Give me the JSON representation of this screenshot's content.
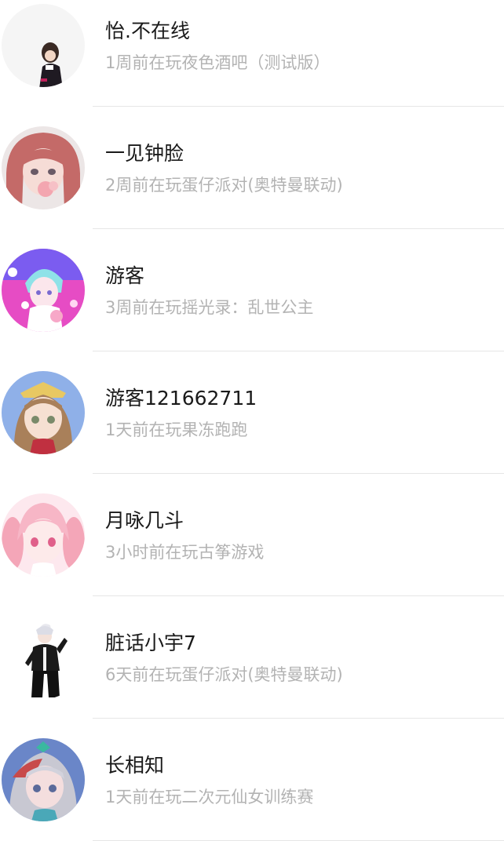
{
  "friends": [
    {
      "name": "怡.不在线",
      "status": "1周前在玩夜色酒吧（测试版）",
      "avatar_icon": "chibi-character-avatar-icon"
    },
    {
      "name": "一见钟脸",
      "status": "2周前在玩蛋仔派对(奥特曼联动)",
      "avatar_icon": "anime-girl-pink-hair-avatar-icon"
    },
    {
      "name": "游客",
      "status": "3周前在玩摇光录：乱世公主",
      "avatar_icon": "anime-boy-cyan-hair-avatar-icon"
    },
    {
      "name": "游客121662711",
      "status": "1天前在玩果冻跑跑",
      "avatar_icon": "anime-girl-brown-hair-avatar-icon"
    },
    {
      "name": "月咏几斗",
      "status": "3小时前在玩古筝游戏",
      "avatar_icon": "anime-girl-pink-twintails-avatar-icon"
    },
    {
      "name": "脏话小宇7",
      "status": "6天前在玩蛋仔派对(奥特曼联动)",
      "avatar_icon": "chibi-boy-black-jacket-avatar-icon"
    },
    {
      "name": "长相知",
      "status": "1天前在玩二次元仙女训练赛",
      "avatar_icon": "anime-girl-silver-hair-avatar-icon"
    }
  ],
  "colors": {
    "name_text": "#1a1a1a",
    "status_text": "#b3b3b3",
    "divider": "#e6e6e6",
    "background": "#ffffff"
  }
}
